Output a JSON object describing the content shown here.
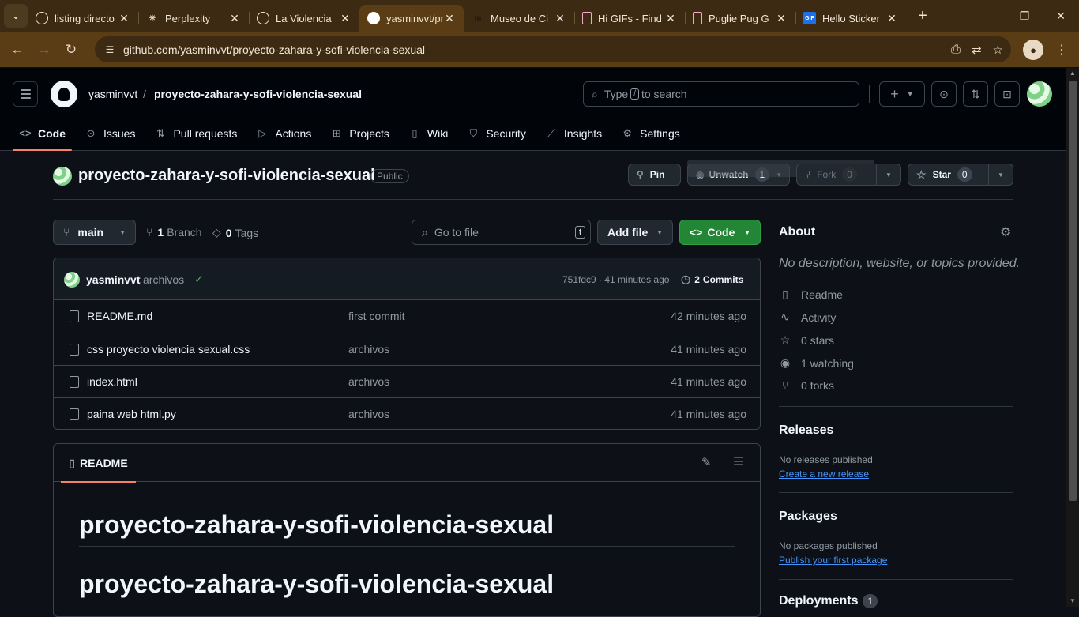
{
  "browser": {
    "tabs": [
      {
        "title": "listing directo"
      },
      {
        "title": "Perplexity"
      },
      {
        "title": "La Violencia"
      },
      {
        "title": "yasminvvt/pr"
      },
      {
        "title": "Museo de Ci"
      },
      {
        "title": "Hi GIFs - Find"
      },
      {
        "title": "Puglie Pug G"
      },
      {
        "title": "Hello Sticker"
      }
    ],
    "url": "github.com/yasminvvt/proyecto-zahara-y-sofi-violencia-sexual"
  },
  "header": {
    "owner": "yasminvvt",
    "separator": "/",
    "repo": "proyecto-zahara-y-sofi-violencia-sexual",
    "search_before": "Type",
    "search_key": "/",
    "search_after": "to search"
  },
  "nav": [
    {
      "label": "Code",
      "icon": "code-icon",
      "active": true
    },
    {
      "label": "Issues",
      "icon": "issue-icon"
    },
    {
      "label": "Pull requests",
      "icon": "pull-request-icon"
    },
    {
      "label": "Actions",
      "icon": "play-icon"
    },
    {
      "label": "Projects",
      "icon": "table-icon"
    },
    {
      "label": "Wiki",
      "icon": "book-icon"
    },
    {
      "label": "Security",
      "icon": "shield-icon"
    },
    {
      "label": "Insights",
      "icon": "graph-icon"
    },
    {
      "label": "Settings",
      "icon": "gear-icon"
    }
  ],
  "repo": {
    "title": "proyecto-zahara-y-sofi-violencia-sexual",
    "visibility": "Public",
    "pin": "Pin",
    "unwatch": "Unwatch",
    "watch_count": "1",
    "fork": "Fork",
    "fork_count": "0",
    "star": "Star",
    "star_count": "0"
  },
  "toolbar": {
    "branch": "main",
    "branches_count": "1",
    "branches_label": "Branch",
    "tags_count": "0",
    "tags_label": "Tags",
    "goto_placeholder": "Go to file",
    "goto_key": "t",
    "add_file": "Add file",
    "code": "Code"
  },
  "commit": {
    "author": "yasminvvt",
    "message": "archivos",
    "hash_time": "751fdc9 · 41 minutes ago",
    "commits_count": "2",
    "commits_label": "Commits"
  },
  "files": [
    {
      "name": "README.md",
      "message": "first commit",
      "time": "42 minutes ago"
    },
    {
      "name": "css proyecto violencia sexual.css",
      "message": "archivos",
      "time": "41 minutes ago"
    },
    {
      "name": "index.html",
      "message": "archivos",
      "time": "41 minutes ago"
    },
    {
      "name": "paina web html.py",
      "message": "archivos",
      "time": "41 minutes ago"
    }
  ],
  "readme": {
    "tab": "README",
    "h1_first": "proyecto-zahara-y-sofi-violencia-sexual",
    "h1_second": "proyecto-zahara-y-sofi-violencia-sexual"
  },
  "about": {
    "heading": "About",
    "description": "No description, website, or topics provided.",
    "items": [
      {
        "label": "Readme",
        "icon": "book-icon"
      },
      {
        "label": "Activity",
        "icon": "pulse-icon"
      },
      {
        "label": "0 stars",
        "icon": "star-icon"
      },
      {
        "label": "1 watching",
        "icon": "eye-icon"
      },
      {
        "label": "0 forks",
        "icon": "fork-icon"
      }
    ]
  },
  "releases": {
    "heading": "Releases",
    "none": "No releases published",
    "link": "Create a new release"
  },
  "packages": {
    "heading": "Packages",
    "none": "No packages published",
    "link": "Publish your first package"
  },
  "deployments": {
    "heading": "Deployments",
    "count": "1"
  },
  "colors": {
    "accent_green": "#238636",
    "nav_underline": "#f78166",
    "link": "#4493f8",
    "browser_frame": "#5a3d14"
  }
}
